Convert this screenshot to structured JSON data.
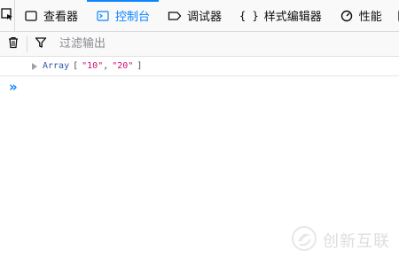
{
  "toolbar": {
    "tabs": [
      {
        "label": "查看器",
        "icon": "inspector-icon"
      },
      {
        "label": "控制台",
        "icon": "console-icon",
        "selected": true
      },
      {
        "label": "调试器",
        "icon": "debugger-icon"
      },
      {
        "label": "样式编辑器",
        "icon": "style-editor-braces-icon"
      },
      {
        "label": "性能",
        "icon": "performance-icon"
      }
    ]
  },
  "filterbar": {
    "placeholder": "过滤输出"
  },
  "output": {
    "type_word": "Array",
    "open_bracket": "[",
    "items": [
      "\"10\"",
      "\"20\""
    ],
    "comma": ",",
    "close_bracket": "]"
  },
  "prompt": {
    "symbol": "»"
  },
  "watermark": {
    "text": "创新互联"
  },
  "colors": {
    "accent": "#0a84ff",
    "string": "#d10f6f",
    "keyword": "#2b5aa5"
  }
}
